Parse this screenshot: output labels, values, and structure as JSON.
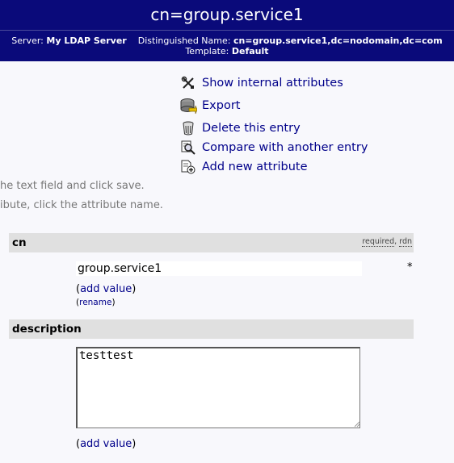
{
  "header": {
    "title": "cn=group.service1"
  },
  "info": {
    "server_label": "Server:",
    "server_value": "My LDAP Server",
    "dn_label": "Distinguished Name:",
    "dn_value": "cn=group.service1,dc=nodomain,dc=com",
    "template_label": "Template:",
    "template_value": "Default"
  },
  "actions": [
    {
      "label": "Show internal attributes",
      "icon": "tools-icon"
    },
    {
      "label": "Export",
      "icon": "export-icon"
    },
    {
      "label": "Delete this entry",
      "icon": "trash-icon"
    },
    {
      "label": "Compare with another entry",
      "icon": "compare-icon"
    },
    {
      "label": "Add new attribute",
      "icon": "add-attribute-icon"
    }
  ],
  "hints": {
    "line1": "he text field and click save.",
    "line2": "ibute, click the attribute name."
  },
  "attributes": {
    "cn": {
      "name": "cn",
      "tag_required": "required",
      "tag_sep": ",",
      "tag_rdn": "rdn",
      "value": "group.service1",
      "required_marker": "*",
      "add_value": "add value",
      "rename": "rename"
    },
    "description": {
      "name": "description",
      "value": "testtest",
      "add_value": "add value"
    }
  },
  "punct": {
    "open": "(",
    "close": ")"
  }
}
